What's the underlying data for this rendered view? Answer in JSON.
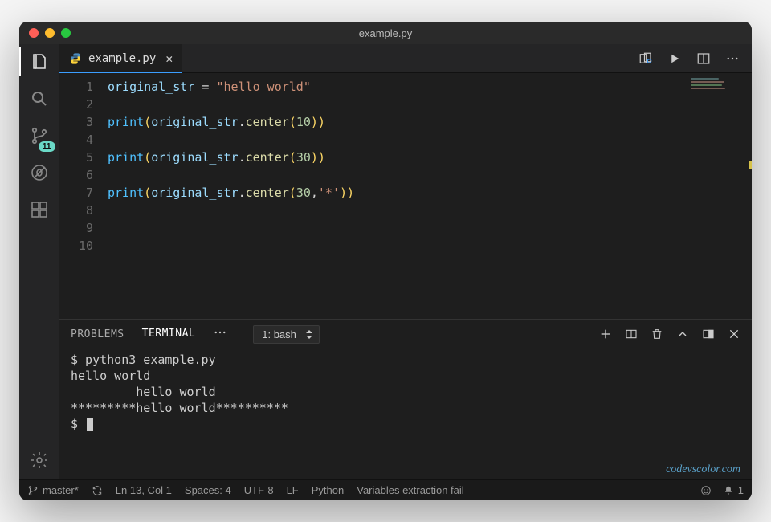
{
  "window": {
    "title": "example.py"
  },
  "activitybar": {
    "scm_badge": "11"
  },
  "tab": {
    "filename": "example.py"
  },
  "code": {
    "lines": [
      {
        "n": "1",
        "html": "<span class='tok-var'>original_str</span> <span class='tok-op'>=</span> <span class='tok-str'>\"hello world\"</span>"
      },
      {
        "n": "2",
        "html": ""
      },
      {
        "n": "3",
        "html": "<span class='tok-kw'>print</span><span class='tok-punc'>(</span><span class='tok-var'>original_str</span>.<span class='tok-func'>center</span><span class='tok-punc'>(</span><span class='tok-num'>10</span><span class='tok-punc'>))</span>"
      },
      {
        "n": "4",
        "html": ""
      },
      {
        "n": "5",
        "html": "<span class='tok-kw'>print</span><span class='tok-punc'>(</span><span class='tok-var'>original_str</span>.<span class='tok-func'>center</span><span class='tok-punc'>(</span><span class='tok-num'>30</span><span class='tok-punc'>))</span>"
      },
      {
        "n": "6",
        "html": ""
      },
      {
        "n": "7",
        "html": "<span class='tok-kw'>print</span><span class='tok-punc'>(</span><span class='tok-var'>original_str</span>.<span class='tok-func'>center</span><span class='tok-punc'>(</span><span class='tok-num'>30</span>,<span class='tok-str'>'*'</span><span class='tok-punc'>))</span>"
      },
      {
        "n": "8",
        "html": ""
      },
      {
        "n": "9",
        "html": ""
      },
      {
        "n": "10",
        "html": ""
      }
    ]
  },
  "panel": {
    "tabs": {
      "problems": "PROBLEMS",
      "terminal": "TERMINAL"
    },
    "terminal_selector": "1: bash",
    "terminal_output": "$ python3 example.py\nhello world\n         hello world          \n*********hello world**********\n$ "
  },
  "status": {
    "branch": "master*",
    "position": "Ln 13, Col 1",
    "spaces": "Spaces: 4",
    "encoding": "UTF-8",
    "eol": "LF",
    "language": "Python",
    "extra": "Variables extraction fail",
    "bell_count": "1"
  },
  "watermark": "codevscolor.com"
}
